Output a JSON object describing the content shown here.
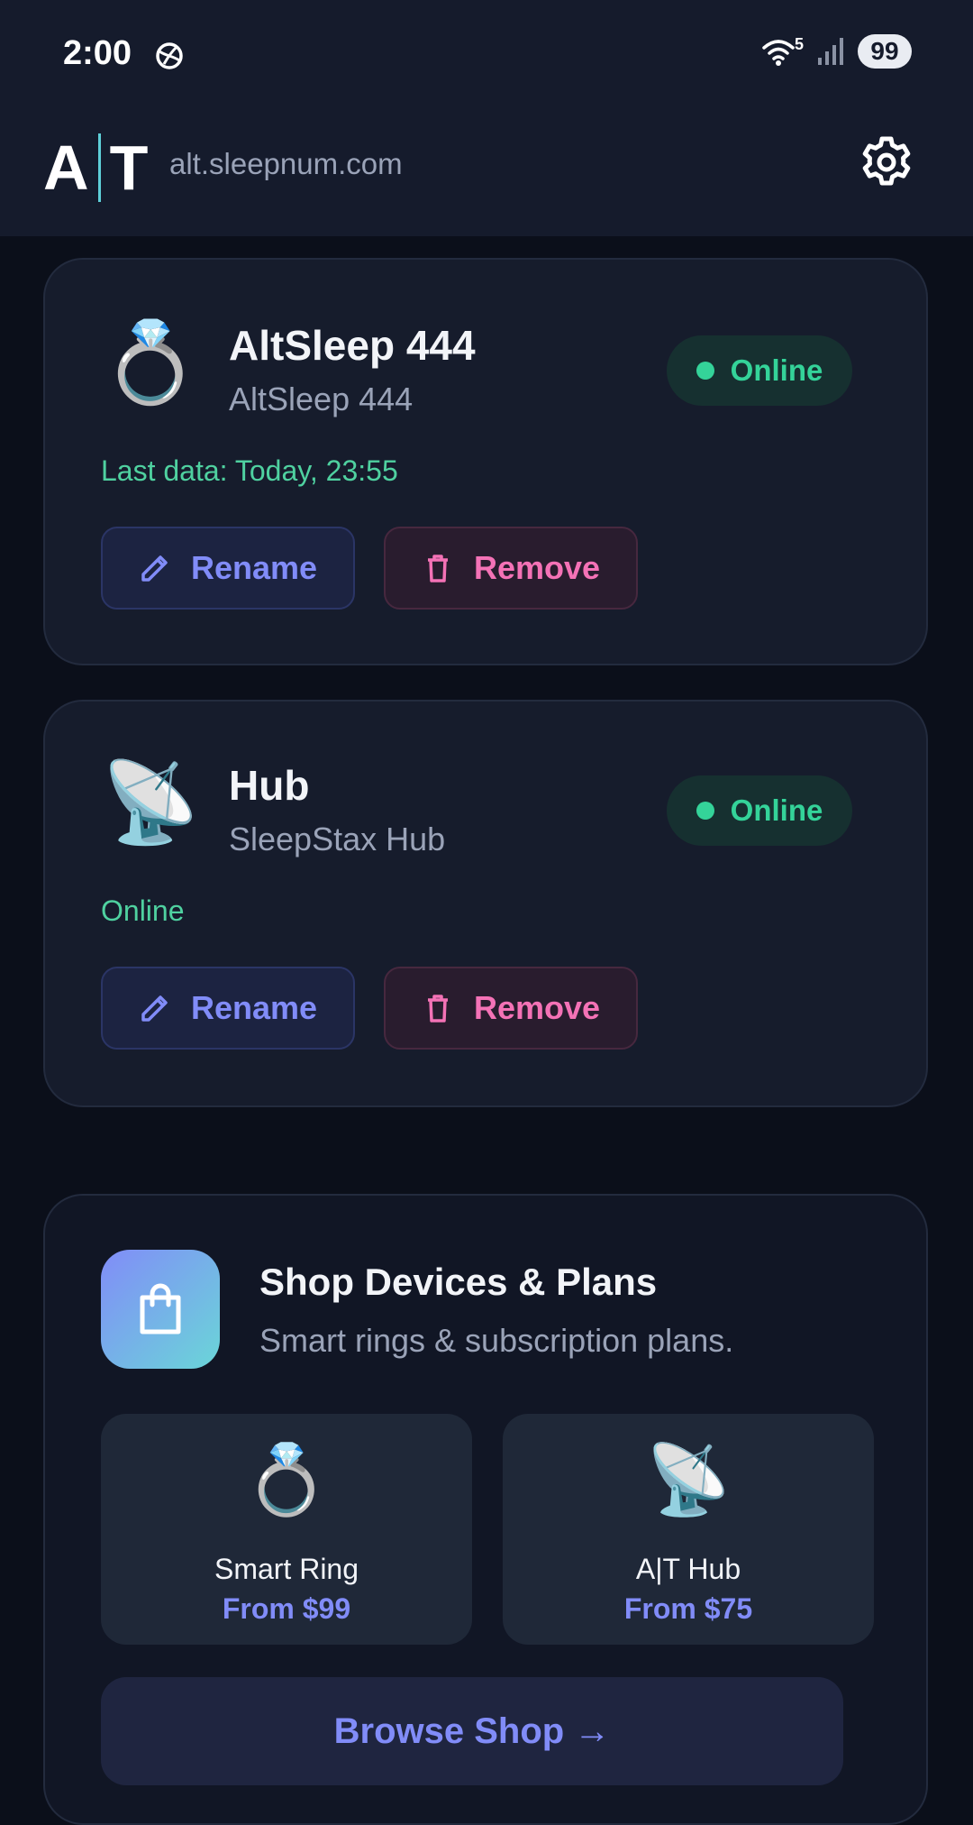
{
  "status_bar": {
    "time": "2:00",
    "wifi_badge": "5",
    "battery": "99"
  },
  "app_bar": {
    "logo_left": "A",
    "logo_right": "T",
    "domain": "alt.sleepnum.com"
  },
  "devices": [
    {
      "emoji": "💍",
      "title": "AltSleep 444",
      "subtitle": "AltSleep 444",
      "badge": "Online",
      "status_line": "Last data: Today, 23:55",
      "rename_label": "Rename",
      "remove_label": "Remove"
    },
    {
      "emoji": "📡",
      "title": "Hub",
      "subtitle": "SleepStax Hub",
      "badge": "Online",
      "status_line": "Online",
      "rename_label": "Rename",
      "remove_label": "Remove"
    }
  ],
  "shop": {
    "title": "Shop Devices & Plans",
    "subtitle": "Smart rings & subscription plans.",
    "products": [
      {
        "emoji": "💍",
        "name": "Smart Ring",
        "price": "From $99"
      },
      {
        "emoji": "📡",
        "name": "A|T Hub",
        "price": "From $75"
      }
    ],
    "browse_label": "Browse Shop →"
  },
  "colors": {
    "background": "#0b0f1a",
    "accent": "#818cf8",
    "online": "#34d399",
    "remove": "#f472b6"
  }
}
